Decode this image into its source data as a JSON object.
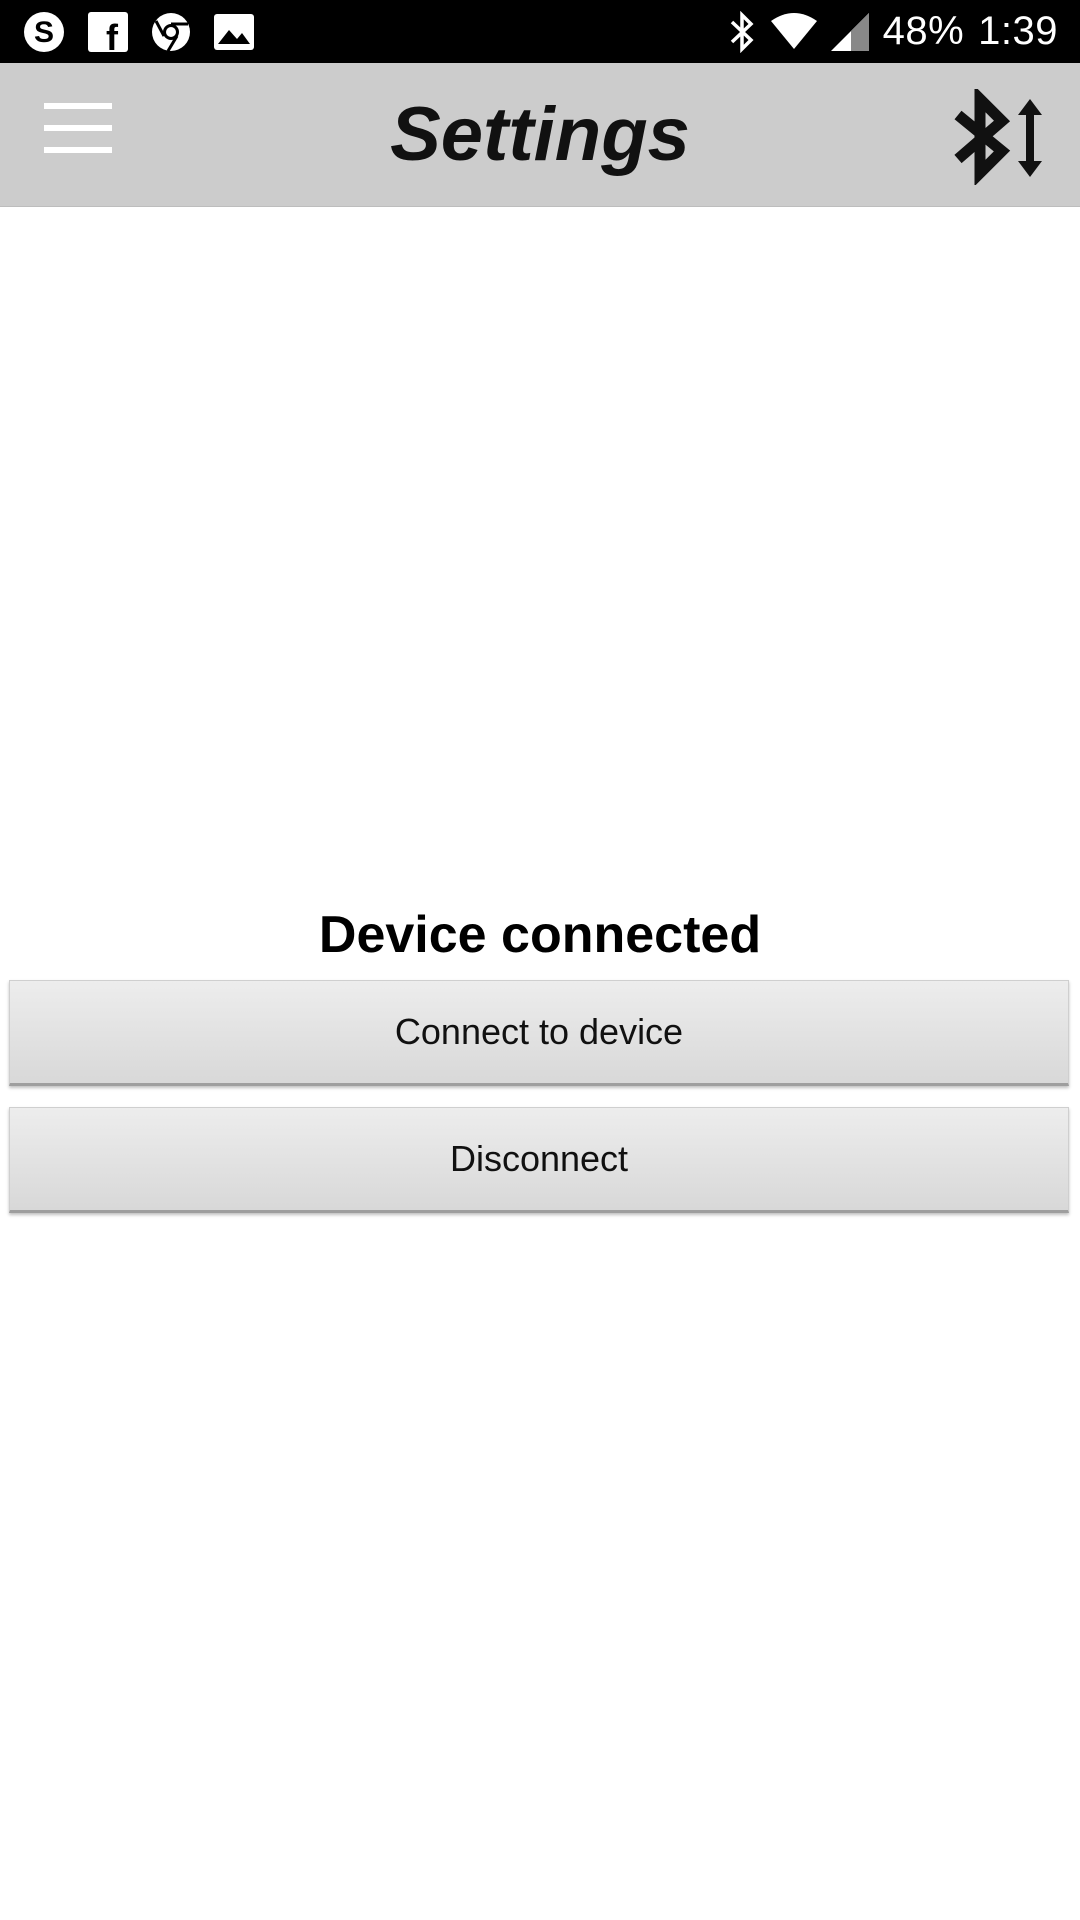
{
  "status_bar": {
    "left_icons": [
      "skype-icon",
      "facebook-icon",
      "chrome-icon",
      "gallery-icon"
    ],
    "right_icons": [
      "bluetooth-icon",
      "wifi-icon",
      "cell-signal-icon"
    ],
    "battery": "48%",
    "time": "1:39"
  },
  "app_bar": {
    "title": "Settings",
    "left_icon": "menu-icon",
    "right_icon": "bluetooth-connect-icon",
    "background": "#cccccc"
  },
  "main": {
    "status_text": "Device connected",
    "buttons": [
      {
        "label": "Connect to device"
      },
      {
        "label": "Disconnect"
      }
    ]
  }
}
